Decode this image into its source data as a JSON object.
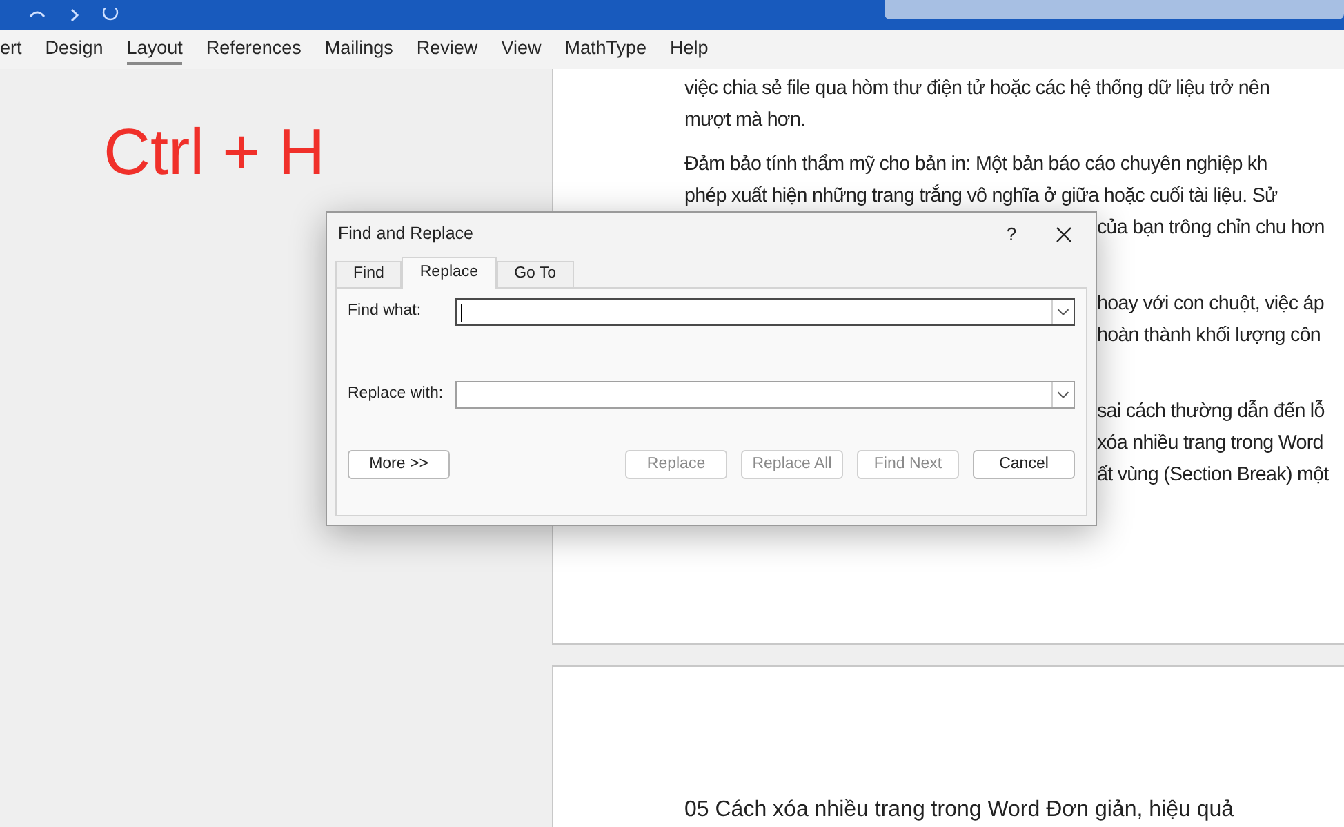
{
  "ribbon": {
    "tabs": [
      {
        "label": "ert",
        "selected": false
      },
      {
        "label": "Design",
        "selected": false
      },
      {
        "label": "Layout",
        "selected": true
      },
      {
        "label": "References",
        "selected": false
      },
      {
        "label": "Mailings",
        "selected": false
      },
      {
        "label": "Review",
        "selected": false
      },
      {
        "label": "View",
        "selected": false
      },
      {
        "label": "MathType",
        "selected": false
      },
      {
        "label": "Help",
        "selected": false
      }
    ]
  },
  "overlay_caption": "Ctrl + H",
  "document": {
    "paragraphs": [
      {
        "lines": [
          {
            "text": "việc chia sẻ file qua hòm thư điện tử hoặc các hệ thống dữ liệu trở nên",
            "kind": "full"
          },
          {
            "text": "mượt mà hơn.",
            "kind": "full"
          }
        ]
      },
      {
        "lines": [
          {
            "text": "Đảm bảo tính thẩm mỹ cho bản in: Một bản báo cáo chuyên nghiệp kh",
            "kind": "full"
          },
          {
            "text": "phép xuất hiện những trang trắng vô nghĩa ở giữa hoặc cuối tài liệu. Sử",
            "kind": "full"
          },
          {
            "text": "của bạn trông chỉn chu hơn",
            "kind": "beside"
          },
          {
            "kind": "hidden"
          }
        ]
      },
      {
        "lines": [
          {
            "text": "hoay với con chuột, việc áp",
            "kind": "beside"
          },
          {
            "text": "hoàn thành khối lượng côn",
            "kind": "beside"
          },
          {
            "kind": "hidden"
          }
        ]
      },
      {
        "lines": [
          {
            "text": "sai cách thường dẫn đến lỗ",
            "kind": "beside"
          },
          {
            "text": "xóa nhiều trang trong Word",
            "kind": "beside"
          },
          {
            "text": "ất vùng (Section Break) một",
            "kind": "beside"
          }
        ]
      }
    ],
    "next_page_heading": "05 Cách xóa nhiều trang trong Word Đơn giản, hiệu quả"
  },
  "dialog": {
    "title": "Find and Replace",
    "help": "?",
    "tabs": [
      {
        "label": "Find",
        "selected": false
      },
      {
        "label": "Replace",
        "selected": true
      },
      {
        "label": "Go To",
        "selected": false
      }
    ],
    "fields": [
      {
        "label": "Find what:",
        "focused": true
      },
      {
        "label": "Replace with:",
        "focused": false
      }
    ],
    "buttons": [
      {
        "label": "More >>",
        "disabled": false,
        "kind": "left"
      },
      {
        "label": "Replace",
        "disabled": true,
        "kind": "right"
      },
      {
        "label": "Replace All",
        "disabled": true,
        "kind": "right"
      },
      {
        "label": "Find Next",
        "disabled": true,
        "kind": "right"
      },
      {
        "label": "Cancel",
        "disabled": false,
        "kind": "right"
      }
    ]
  }
}
